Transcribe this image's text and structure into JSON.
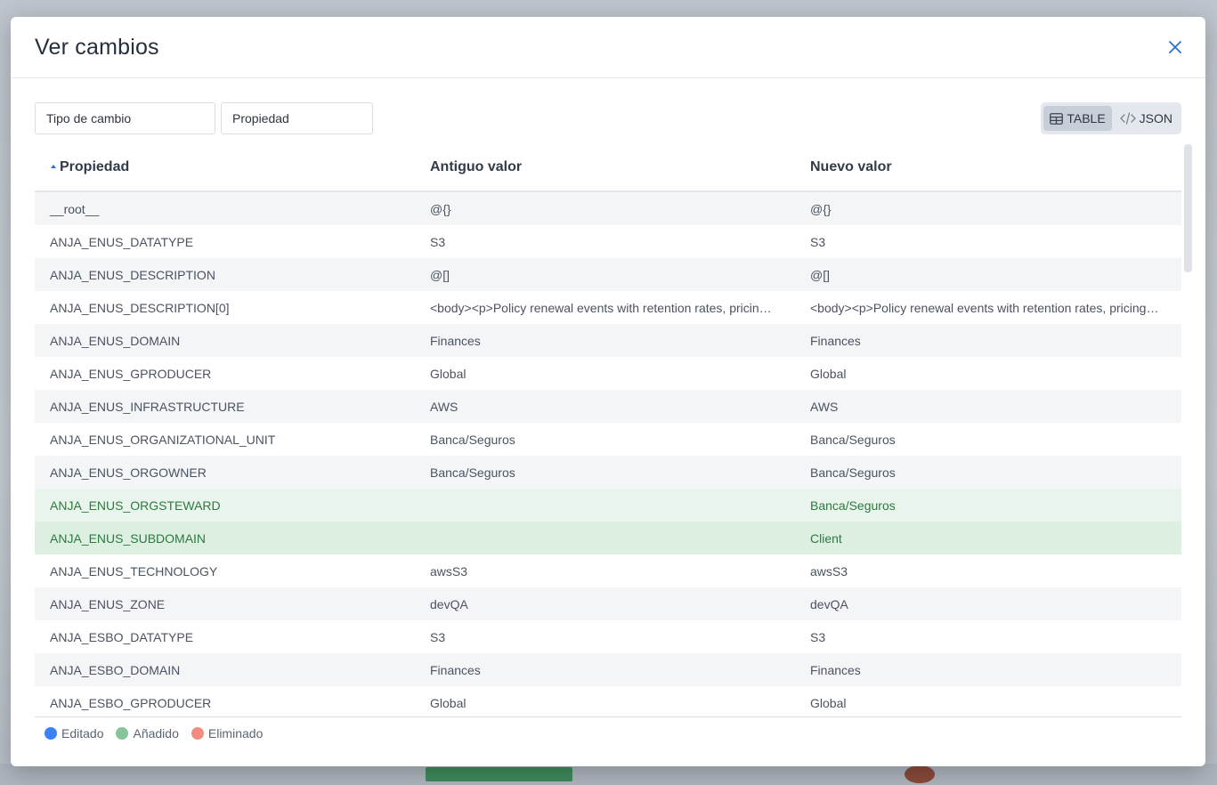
{
  "modal": {
    "title": "Ver cambios"
  },
  "filters": {
    "change_type_placeholder": "Tipo de cambio",
    "property_placeholder": "Propiedad"
  },
  "view_toggle": {
    "table_label": "TABLE",
    "json_label": "JSON",
    "active": "table"
  },
  "table": {
    "columns": [
      "Propiedad",
      "Antiguo valor",
      "Nuevo valor"
    ],
    "sort": {
      "column": "Propiedad",
      "direction": "asc"
    },
    "rows": [
      {
        "property": "__root__",
        "old": "@{}",
        "new": "@{}",
        "status": "unchanged"
      },
      {
        "property": "ANJA_ENUS_DATATYPE",
        "old": "S3",
        "new": "S3",
        "status": "unchanged"
      },
      {
        "property": "ANJA_ENUS_DESCRIPTION",
        "old": "@[]",
        "new": "@[]",
        "status": "unchanged"
      },
      {
        "property": "ANJA_ENUS_DESCRIPTION[0]",
        "old": "<body><p>Policy renewal events with retention rates, pricing changes and customer behavior</p></body>",
        "new": "<body><p>Policy renewal events with retention rates, pricing changes and customer behavior</p></body>",
        "status": "unchanged"
      },
      {
        "property": "ANJA_ENUS_DOMAIN",
        "old": "Finances",
        "new": "Finances",
        "status": "unchanged"
      },
      {
        "property": "ANJA_ENUS_GPRODUCER",
        "old": "Global",
        "new": "Global",
        "status": "unchanged"
      },
      {
        "property": "ANJA_ENUS_INFRASTRUCTURE",
        "old": "AWS",
        "new": "AWS",
        "status": "unchanged"
      },
      {
        "property": "ANJA_ENUS_ORGANIZATIONAL_UNIT",
        "old": "Banca/Seguros",
        "new": "Banca/Seguros",
        "status": "unchanged"
      },
      {
        "property": "ANJA_ENUS_ORGOWNER",
        "old": "Banca/Seguros",
        "new": "Banca/Seguros",
        "status": "unchanged"
      },
      {
        "property": "ANJA_ENUS_ORGSTEWARD",
        "old": "",
        "new": "Banca/Seguros",
        "status": "added"
      },
      {
        "property": "ANJA_ENUS_SUBDOMAIN",
        "old": "",
        "new": "Client",
        "status": "added"
      },
      {
        "property": "ANJA_ENUS_TECHNOLOGY",
        "old": "awsS3",
        "new": "awsS3",
        "status": "unchanged"
      },
      {
        "property": "ANJA_ENUS_ZONE",
        "old": "devQA",
        "new": "devQA",
        "status": "unchanged"
      },
      {
        "property": "ANJA_ESBO_DATATYPE",
        "old": "S3",
        "new": "S3",
        "status": "unchanged"
      },
      {
        "property": "ANJA_ESBO_DOMAIN",
        "old": "Finances",
        "new": "Finances",
        "status": "unchanged"
      },
      {
        "property": "ANJA_ESBO_GPRODUCER",
        "old": "Global",
        "new": "Global",
        "status": "unchanged"
      }
    ]
  },
  "legend": [
    {
      "label": "Editado",
      "color": "#3b82f6"
    },
    {
      "label": "Añadido",
      "color": "#86c59a"
    },
    {
      "label": "Eliminado",
      "color": "#f08c80"
    }
  ],
  "colors": {
    "accent": "#2b6fd6",
    "added_text": "#2c7a3f"
  }
}
